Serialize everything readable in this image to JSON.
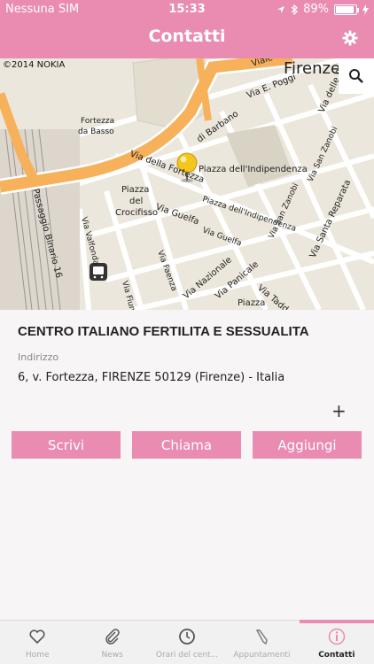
{
  "status_bar": {
    "carrier": "Nessuna SIM",
    "time": "15:33",
    "battery": "89%",
    "battery_level": 0.89
  },
  "nav": {
    "title": "Contatti"
  },
  "map": {
    "copyright": "©2014 NOKIA",
    "labels": {
      "city": "Firenze",
      "viale": "Viale S",
      "poggi": "Via E. Poggi",
      "ruote": "Via delle Ruote",
      "barbano": "di Barbano",
      "fortezza_basso": "Fortezza da Basso",
      "indipendenza": "Piazza dell'Indipendenza",
      "san_zanobi": "Via San Zanobi",
      "via_fortezza": "Via della Fortezza",
      "piazza_indip": "Piazza dell'Indipendenza",
      "piazza_crocifisso": "Piazza del Crocifisso",
      "guelfa": "Via Guelfa",
      "guelfa2": "Via Guelfa",
      "san_zanobi2": "Via San Zanobi",
      "santa_reparata": "Via Santa Reparata",
      "valfonda": "Via Valfonda",
      "passaggio": "Passaggio Binario 16",
      "faenza": "Via Faenza",
      "fiume": "Via Fiume",
      "nazionale": "Via Nazionale",
      "panicale": "Via Panicale",
      "taddea": "Via Taddea",
      "piazza": "Piazza"
    }
  },
  "contact": {
    "name": "CENTRO ITALIANO FERTILITA E SESSUALITA",
    "address_label": "Indirizzo",
    "address": "6, v. Fortezza, FIRENZE 50129 (Firenze) - Italia",
    "plus": "+"
  },
  "actions": {
    "write": "Scrivi",
    "call": "Chiama",
    "add": "Aggiungi"
  },
  "tabs": [
    {
      "label": "Home",
      "icon": "heart-icon"
    },
    {
      "label": "News",
      "icon": "paperclip-icon"
    },
    {
      "label": "Orari del cent...",
      "icon": "clock-icon"
    },
    {
      "label": "Appuntamenti",
      "icon": "pencil-icon"
    },
    {
      "label": "Contatti",
      "icon": "info-icon",
      "active": true
    }
  ],
  "colors": {
    "accent": "#ea8bb2",
    "map_bg": "#ece7dc",
    "road_major": "#f6b15a"
  }
}
